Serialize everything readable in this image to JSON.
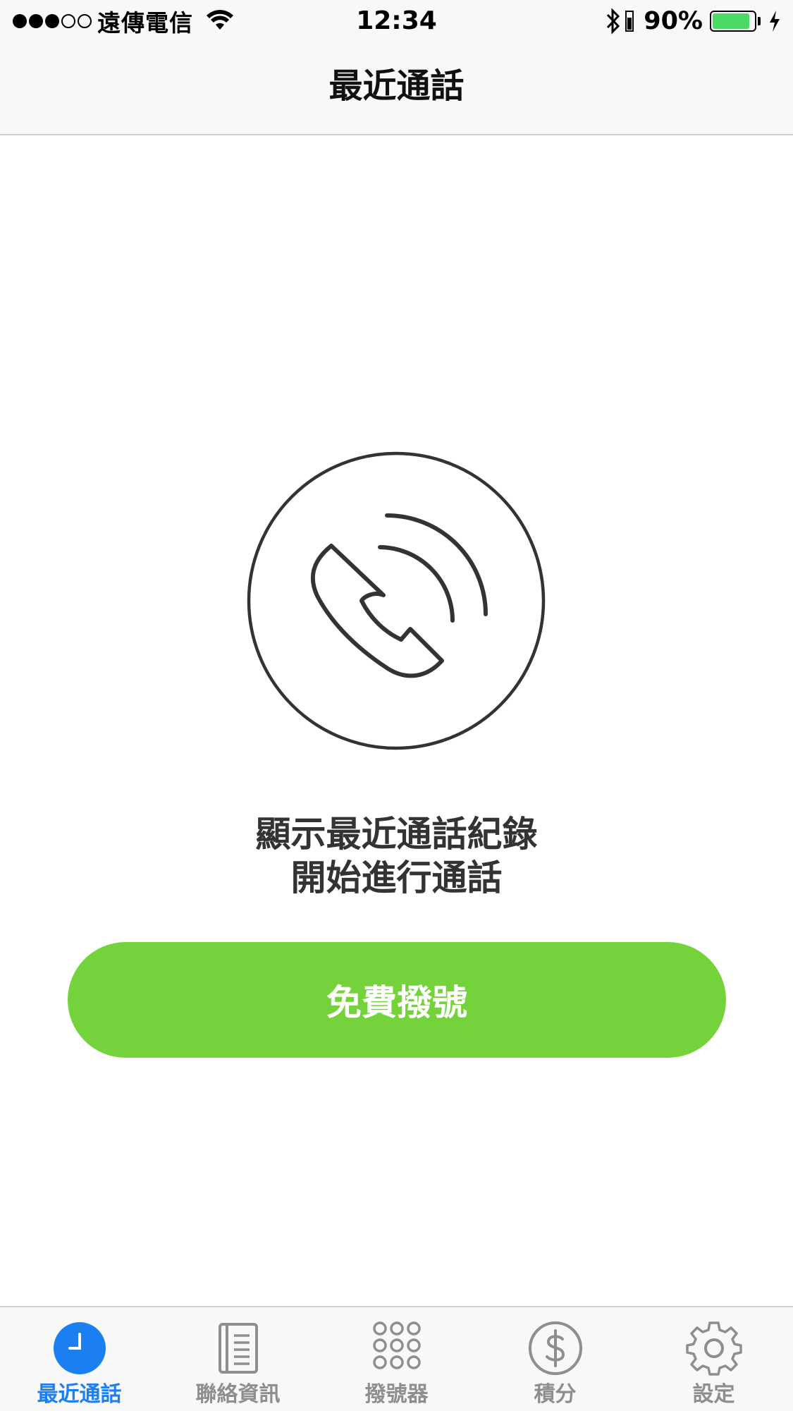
{
  "status_bar": {
    "carrier": "遠傳電信",
    "time": "12:34",
    "battery_percent": "90%",
    "battery_level": 0.9,
    "battery_color": "#4cd964",
    "signal_bars_filled": 3,
    "signal_bars_total": 5
  },
  "nav": {
    "title": "最近通話"
  },
  "empty_state": {
    "icon": "phone-handset-icon",
    "line1": "顯示最近通話紀錄",
    "line2": "開始進行通話"
  },
  "dial_button": {
    "label": "免費撥號",
    "color": "#74d33a"
  },
  "tabs": [
    {
      "label": "最近通話",
      "icon": "clock-icon",
      "active": true
    },
    {
      "label": "聯絡資訊",
      "icon": "contacts-book-icon",
      "active": false
    },
    {
      "label": "撥號器",
      "icon": "keypad-icon",
      "active": false
    },
    {
      "label": "積分",
      "icon": "dollar-coin-icon",
      "active": false
    },
    {
      "label": "設定",
      "icon": "gear-icon",
      "active": false
    }
  ],
  "colors": {
    "active_tab": "#1a7ff0",
    "inactive_tab": "#8e8e8e"
  }
}
